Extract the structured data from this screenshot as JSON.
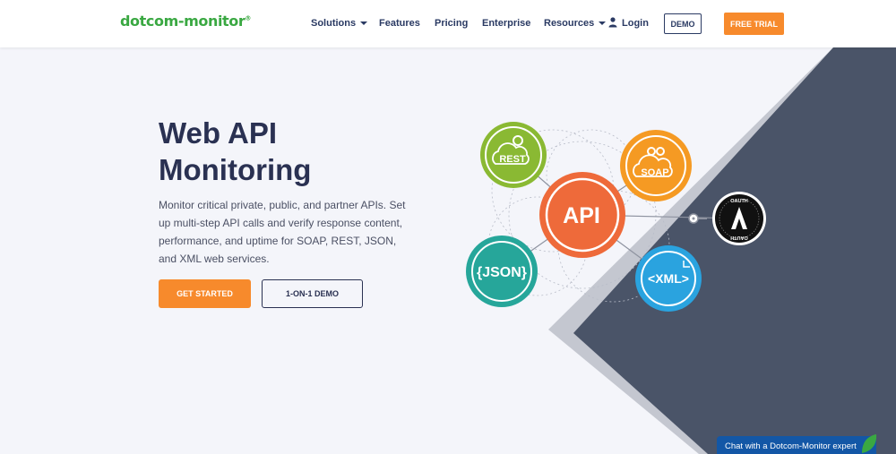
{
  "header": {
    "logo_text": "dotcom-monitor",
    "logo_mark": "®",
    "nav": [
      {
        "label": "Solutions",
        "dropdown": true
      },
      {
        "label": "Features",
        "dropdown": false
      },
      {
        "label": "Pricing",
        "dropdown": false
      },
      {
        "label": "Enterprise",
        "dropdown": false
      },
      {
        "label": "Resources",
        "dropdown": true
      }
    ],
    "login_label": "Login",
    "demo_label": "DEMO",
    "trial_label": "FREE TRIAL"
  },
  "hero": {
    "title": "Web API Monitoring",
    "description": "Monitor critical private, public, and partner APIs. Set up multi-step API calls and verify response content, performance, and uptime for SOAP, REST, JSON, and XML web services.",
    "primary_button": "GET STARTED",
    "secondary_button": "1-ON-1 DEMO"
  },
  "diagram": {
    "center": "API",
    "rest": "REST",
    "soap": "SOAP",
    "json": "{JSON}",
    "xml": "<XML>",
    "oauth_top": "OAUTH",
    "oauth_bottom": "OAUTH"
  },
  "chat": {
    "label": "Chat with a Dotcom-Monitor expert"
  },
  "colors": {
    "brand_green": "#3aa842",
    "accent_orange": "#f78a2c",
    "navy": "#2a3152",
    "rest_green": "#8ab933",
    "soap_orange": "#f59a23",
    "api_orange": "#ee6a3a",
    "json_teal": "#26a69a",
    "xml_blue": "#2aa3df",
    "dark_slate": "#4a5468"
  }
}
